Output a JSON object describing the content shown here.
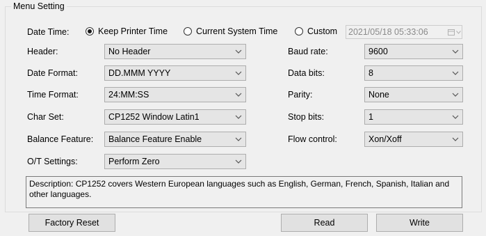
{
  "group": {
    "title": "Menu Setting"
  },
  "datetime": {
    "label": "Date Time:",
    "options": [
      {
        "label": "Keep Printer Time",
        "checked": true
      },
      {
        "label": "Current System Time",
        "checked": false
      },
      {
        "label": "Custom",
        "checked": false
      }
    ],
    "custom_value": "2021/05/18 05:33:06"
  },
  "left_fields": [
    {
      "label": "Header:",
      "value": "No Header"
    },
    {
      "label": "Date Format:",
      "value": "DD.MMM YYYY"
    },
    {
      "label": "Time Format:",
      "value": "24:MM:SS"
    },
    {
      "label": "Char Set:",
      "value": "CP1252 Window Latin1"
    },
    {
      "label": "Balance Feature:",
      "value": "Balance Feature Enable"
    },
    {
      "label": "O/T Settings:",
      "value": "Perform Zero"
    }
  ],
  "right_fields": [
    {
      "label": "Baud rate:",
      "value": "9600"
    },
    {
      "label": "Data bits:",
      "value": "8"
    },
    {
      "label": "Parity:",
      "value": "None"
    },
    {
      "label": "Stop bits:",
      "value": "1"
    },
    {
      "label": "Flow control:",
      "value": "Xon/Xoff"
    }
  ],
  "description": "Description: CP1252 covers Western European languages such as English, German, French, Spanish, Italian and other languages.",
  "buttons": {
    "factory_reset": "Factory Reset",
    "read": "Read",
    "write": "Write"
  },
  "icons": {
    "dropdown": "chevron-down-icon",
    "calendar": "calendar-icon"
  }
}
